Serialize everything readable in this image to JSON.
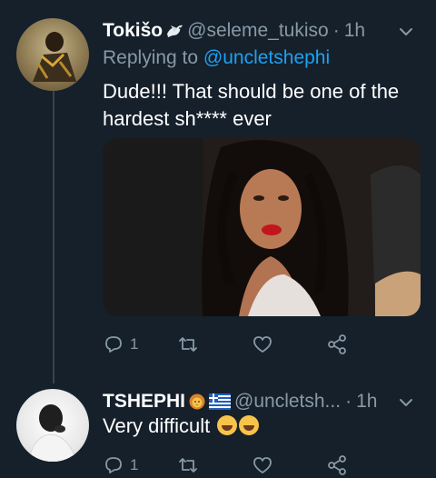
{
  "tweets": [
    {
      "display_name": "Tokišo",
      "handle": "@seleme_tukiso",
      "dot": "·",
      "time": "1h",
      "reply_prefix": "Replying to",
      "reply_to": "@uncletshephi",
      "text": "Dude!!! That should be one of the hardest sh**** ever",
      "reply_count": "1",
      "has_media": true
    },
    {
      "display_name": "TSHEPHI",
      "handle": "@uncletsh...",
      "dot": "·",
      "time": "1h",
      "text": "Very difficult",
      "reply_count": "1"
    }
  ],
  "colors": {
    "background": "#15202b",
    "secondary_text": "#8899a6",
    "link": "#1da1f2",
    "thread_line": "#38444d"
  },
  "icons": [
    "chevron-down-icon",
    "reply-icon",
    "retweet-icon",
    "like-icon",
    "share-icon",
    "dove-emoji",
    "lion-emoji",
    "greece-flag-emoji",
    "tears-of-joy-emoji"
  ]
}
